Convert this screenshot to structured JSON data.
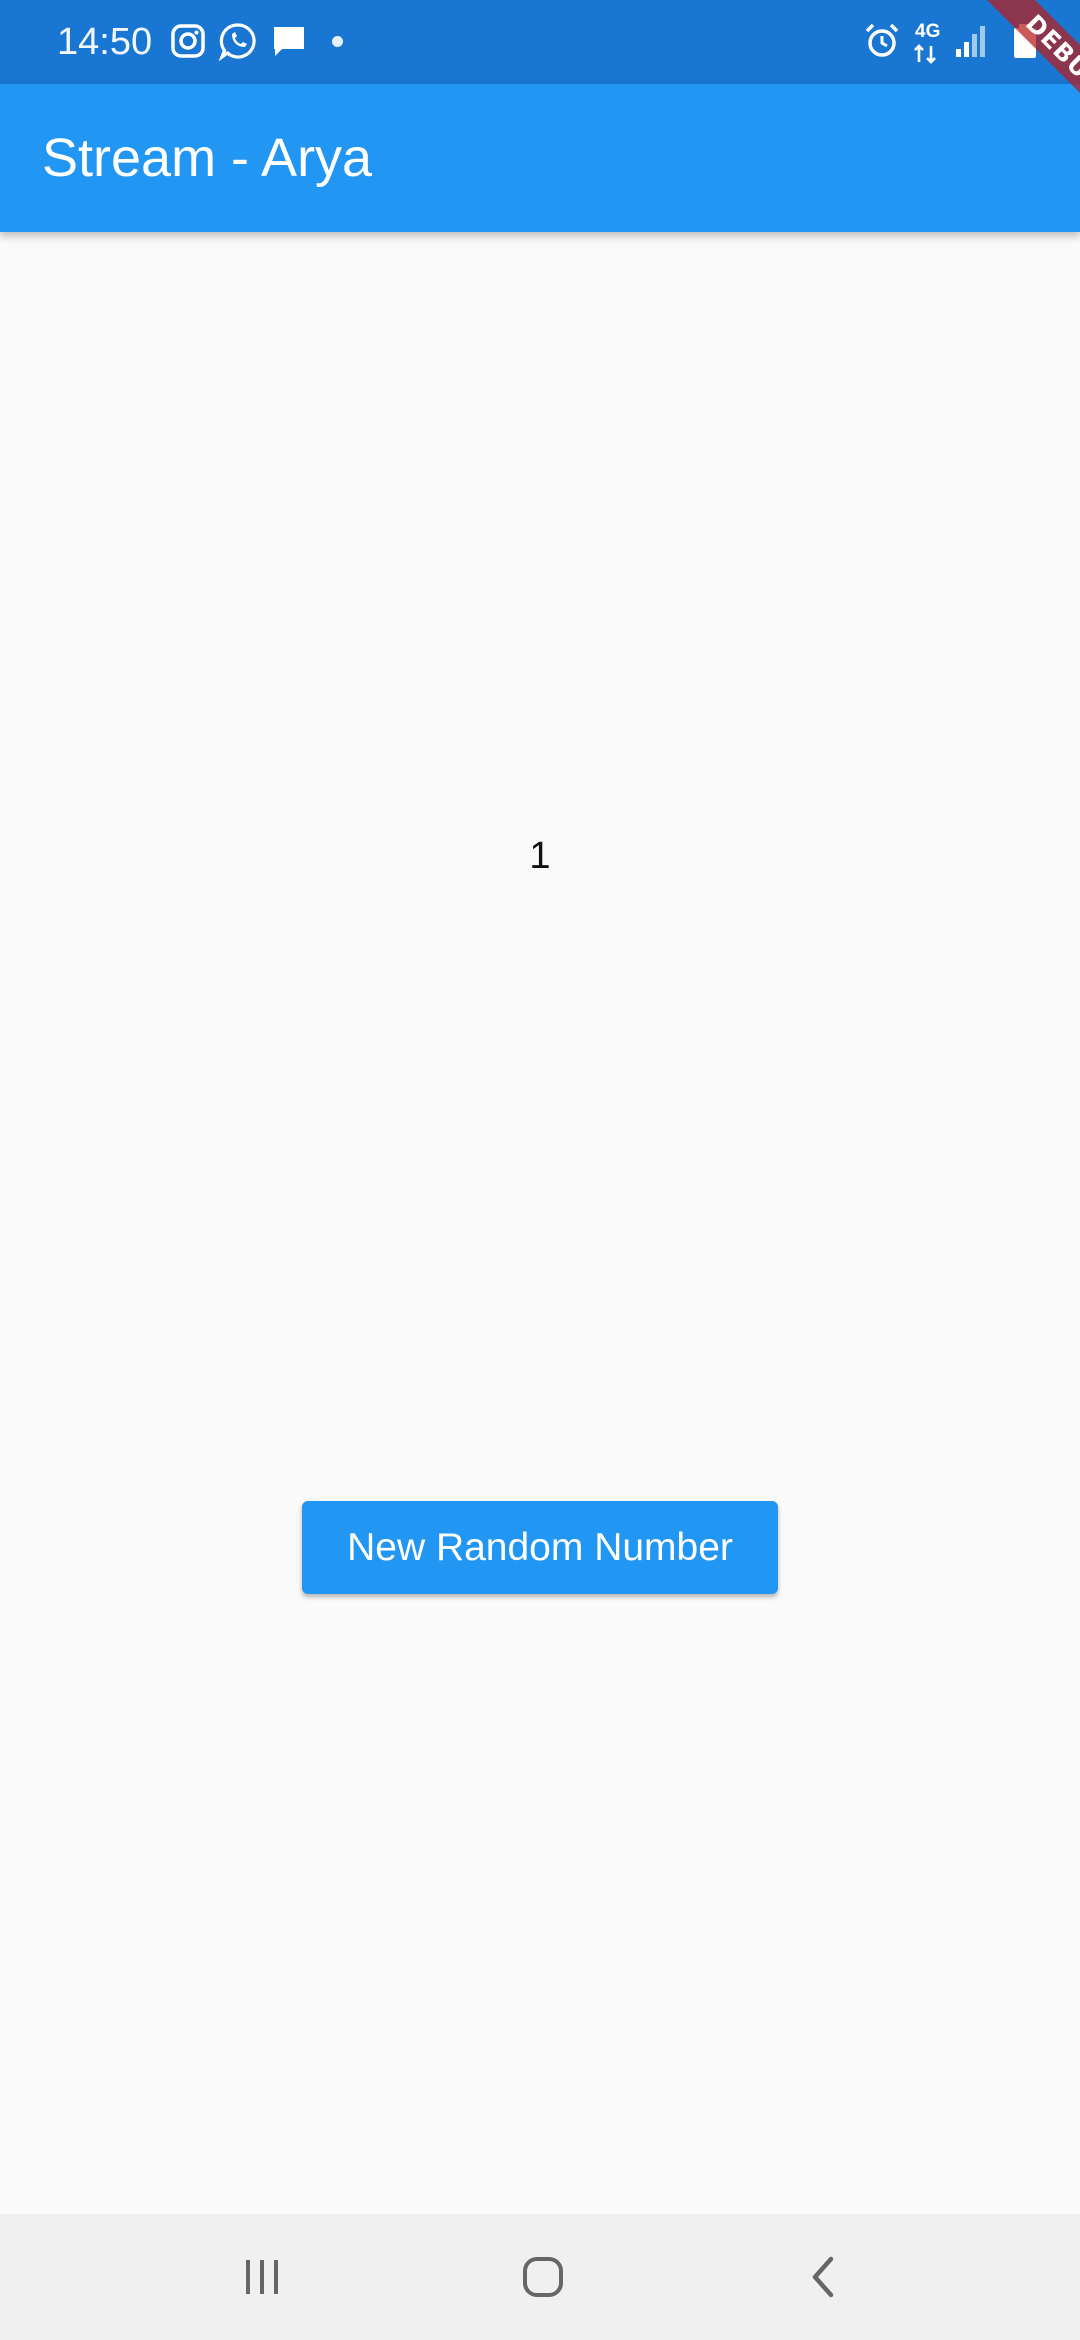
{
  "status_bar": {
    "time": "14:50",
    "network": "4G",
    "notification_icons": [
      "instagram-icon",
      "whatsapp-icon",
      "message-icon"
    ],
    "system_icons": [
      "alarm-icon",
      "signal-icon",
      "battery-icon"
    ]
  },
  "debug_banner": "DEBUG",
  "app_bar": {
    "title": "Stream - Arya"
  },
  "content": {
    "number": "1",
    "button_label": "New Random Number"
  },
  "nav_bar": {
    "buttons": [
      "recent-apps-icon",
      "home-icon",
      "back-icon"
    ]
  },
  "colors": {
    "status_bar": "#1976d2",
    "app_bar": "#2196f3",
    "button": "#2196f3",
    "background": "#fafafa",
    "nav_bar": "#f0f0f0"
  }
}
